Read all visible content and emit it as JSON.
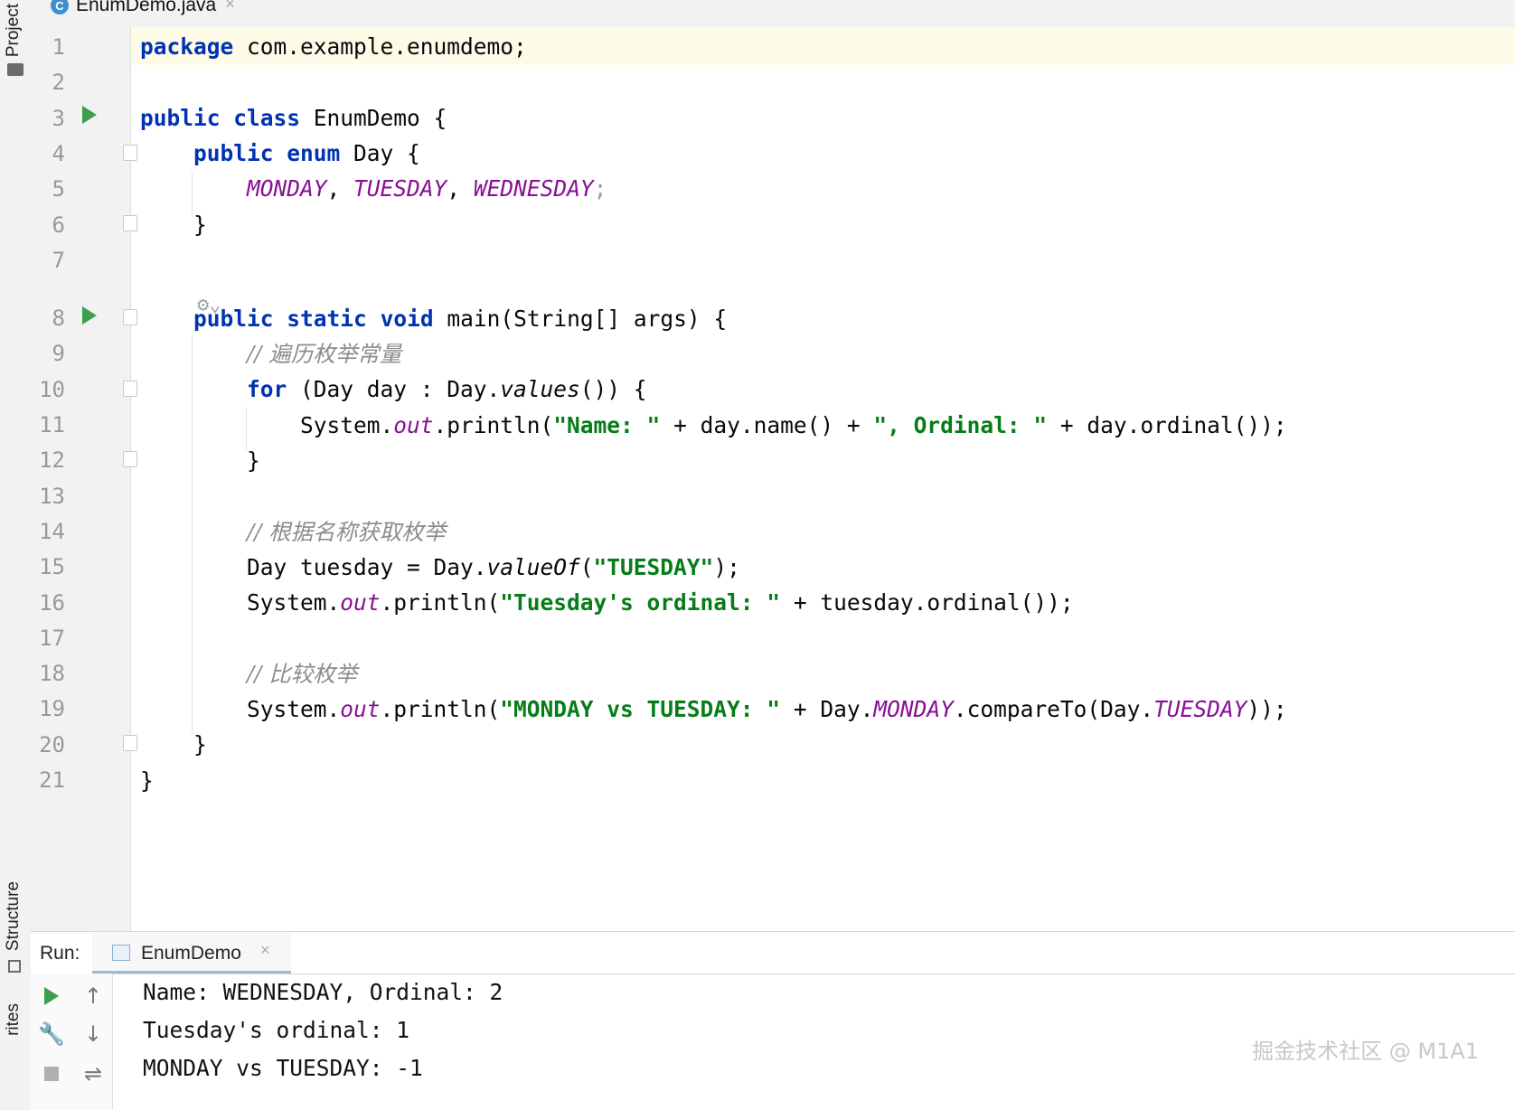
{
  "side_tabs": {
    "project": "Project",
    "structure": "Structure",
    "favorites": "rites"
  },
  "editor_tab": {
    "icon": "C",
    "filename": "EnumDemo.java",
    "close": "×"
  },
  "line_numbers": [
    "1",
    "2",
    "3",
    "4",
    "5",
    "6",
    "7",
    "8",
    "9",
    "10",
    "11",
    "12",
    "13",
    "14",
    "15",
    "16",
    "17",
    "18",
    "19",
    "20",
    "21"
  ],
  "code": {
    "l1": {
      "kw": "package",
      "rest": " com.example.enumdemo;"
    },
    "l3": {
      "kw1": "public",
      "kw2": "class",
      "rest": " EnumDemo {"
    },
    "l4": {
      "kw1": "public",
      "kw2": "enum",
      "rest": " Day {"
    },
    "l5": {
      "c1": "MONDAY",
      "c2": "TUESDAY",
      "c3": "WEDNESDAY",
      "sep": ", ",
      "end": ";"
    },
    "l6": "}",
    "l8": {
      "kw1": "public",
      "kw2": "static",
      "kw3": "void",
      "rest": " main(String[] args) {"
    },
    "l9": "// 遍历枚举常量",
    "l10": {
      "kw": "for",
      "pre": " (Day day : Day.",
      "method": "values",
      "post": "()) {"
    },
    "l11": {
      "pre": "System.",
      "field": "out",
      "mid": ".println(",
      "s1": "\"Name: \"",
      "mid2": " + day.name() + ",
      "s2": "\", Ordinal: \"",
      "post": " + day.ordinal());"
    },
    "l12": "}",
    "l14": "// 根据名称获取枚举",
    "l15": {
      "pre": "Day tuesday = Day.",
      "method": "valueOf",
      "open": "(",
      "s": "\"TUESDAY\"",
      "post": ");"
    },
    "l16": {
      "pre": "System.",
      "field": "out",
      "mid": ".println(",
      "s": "\"Tuesday's ordinal: \"",
      "post": " + tuesday.ordinal());"
    },
    "l18": "// 比较枚举",
    "l19": {
      "pre": "System.",
      "field": "out",
      "mid": ".println(",
      "s": "\"MONDAY vs TUESDAY: \"",
      "mid2": " + Day.",
      "c1": "MONDAY",
      "mid3": ".compareTo(Day.",
      "c2": "TUESDAY",
      "post": "));"
    },
    "l20": "}",
    "l21": "}"
  },
  "run_panel": {
    "label": "Run:",
    "tab_label": "EnumDemo",
    "tab_close": "×",
    "output": [
      "Name: WEDNESDAY, Ordinal: 2",
      "Tuesday's ordinal: 1",
      "MONDAY vs TUESDAY: -1"
    ]
  },
  "watermark": "掘金技术社区 @ M1A1",
  "colors": {
    "keyword": "#0033b3",
    "constant": "#871094",
    "string": "#067d17",
    "comment": "#8c8c8c",
    "run_green": "#3c9f4d",
    "tab_underline": "#4083c9"
  }
}
